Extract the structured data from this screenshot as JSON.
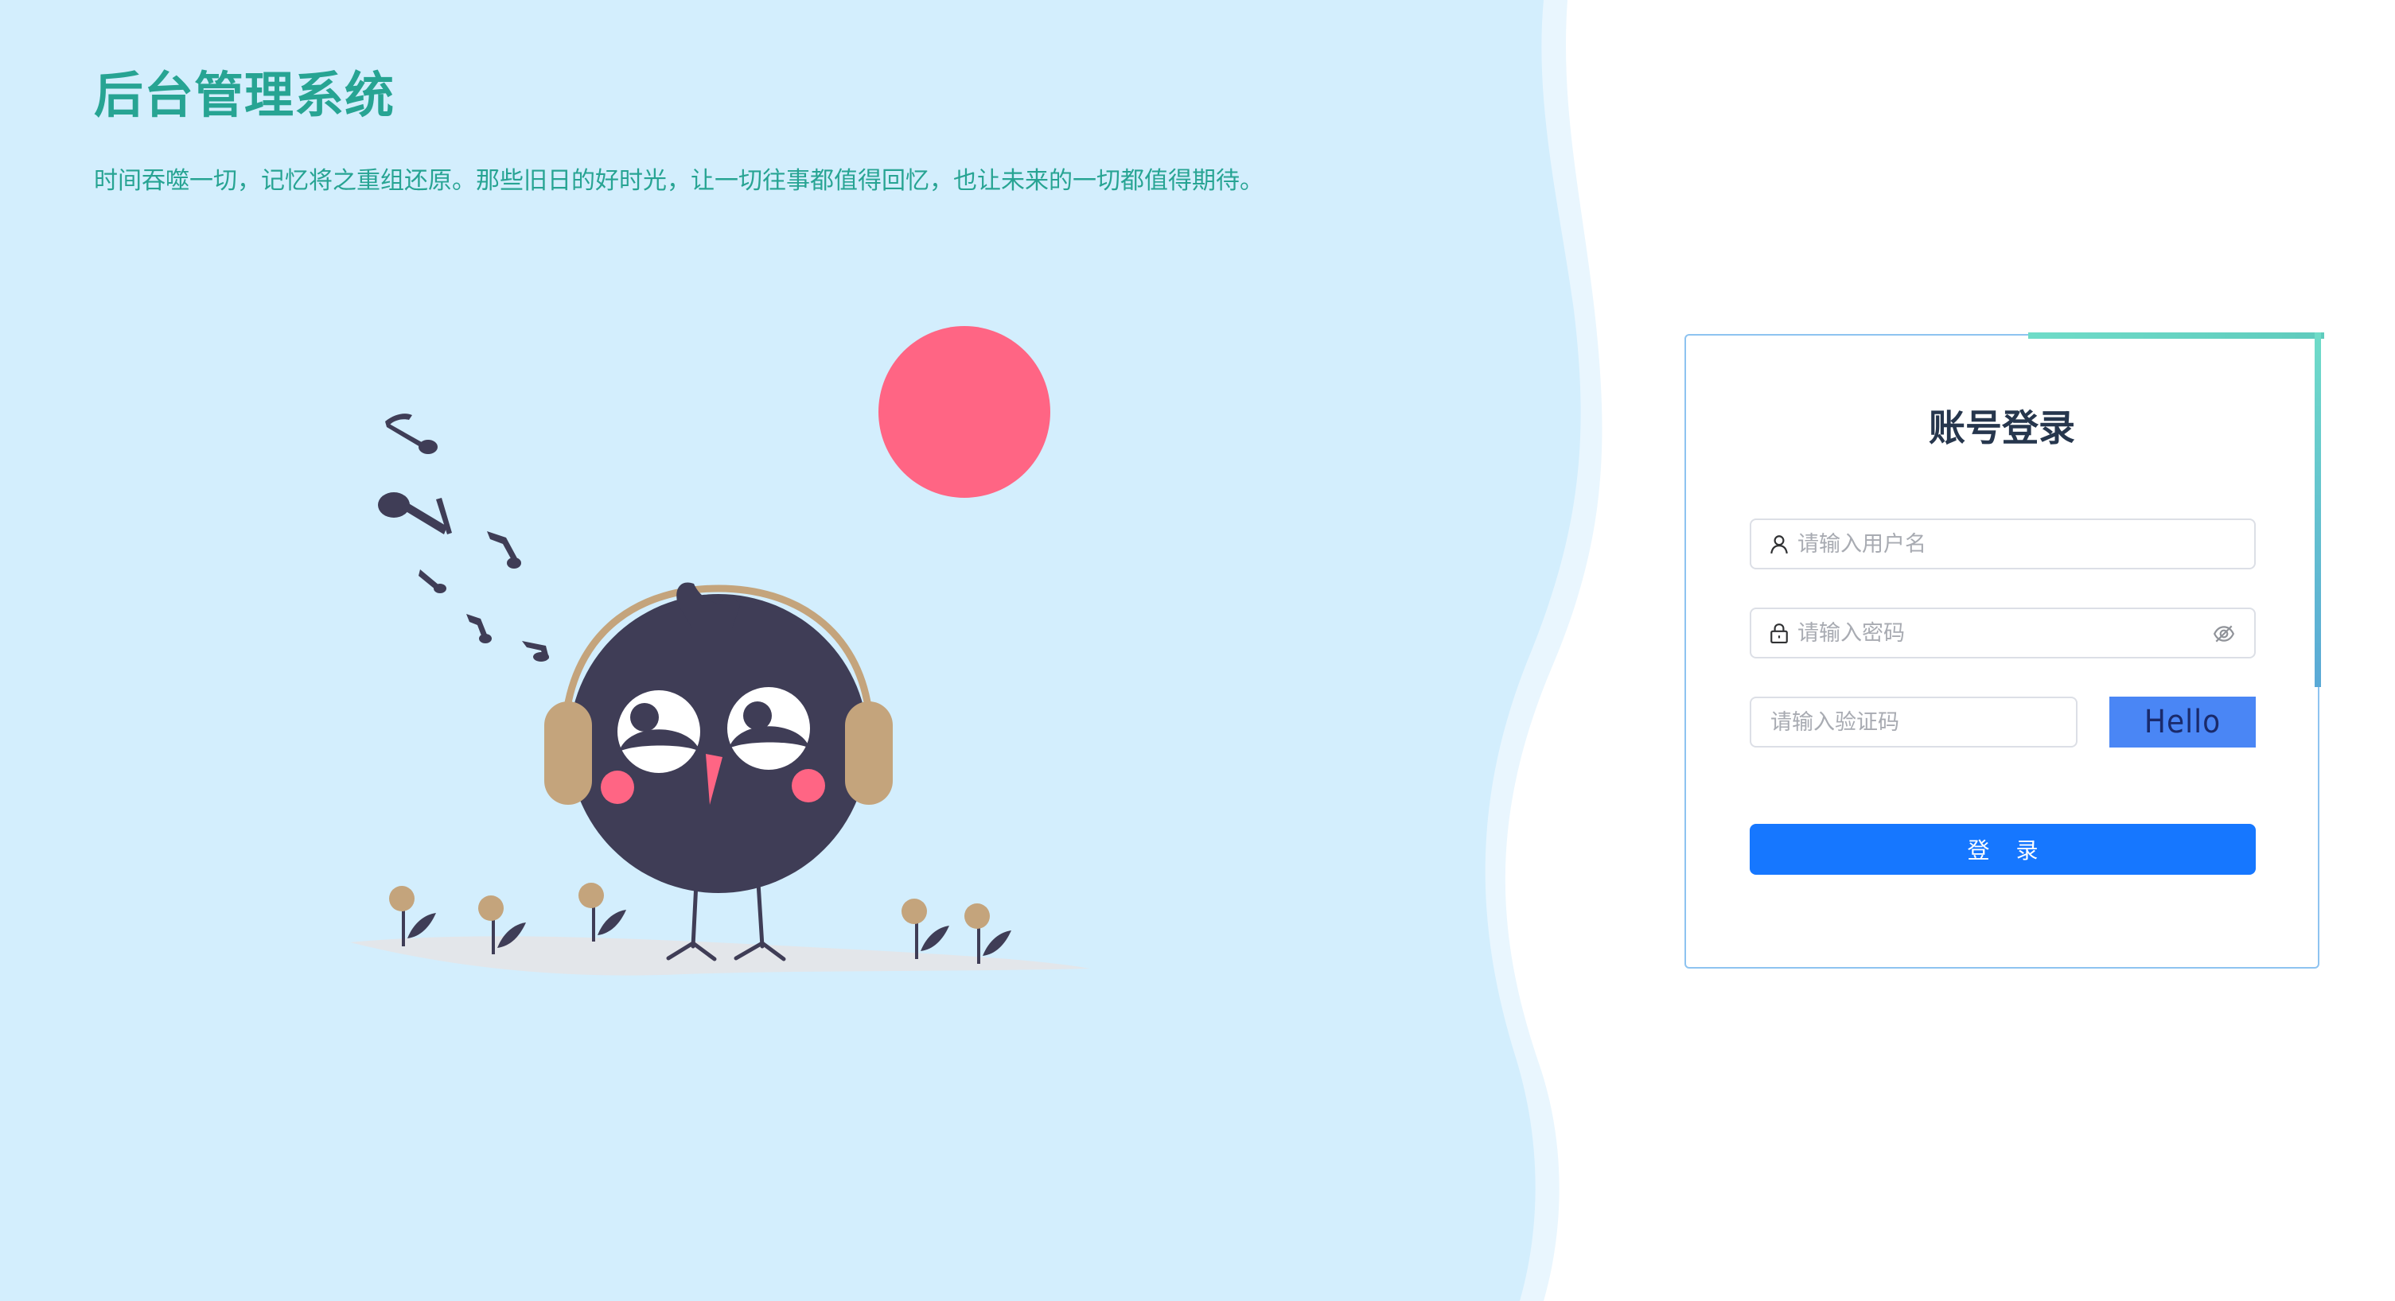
{
  "app": {
    "title": "后台管理系统",
    "subtitle": "时间吞噬一切，记忆将之重组还原。那些旧日的好时光，让一切往事都值得回忆，也让未来的一切都值得期待。"
  },
  "login": {
    "heading": "账号登录",
    "username_placeholder": "请输入用户名",
    "password_placeholder": "请输入密码",
    "captcha_placeholder": "请输入验证码",
    "captcha_text": "Hello",
    "submit_label": "登 录"
  },
  "icons": {
    "username": "user-icon",
    "password": "lock-icon",
    "toggle_password": "eye-off-icon"
  },
  "colors": {
    "left_panel_bg": "#d3eefd",
    "title_text": "#27a493",
    "card_border": "#8ec3f0",
    "card_accent": "#6fdcc8",
    "primary_button": "#1677ff",
    "captcha_bg": "#4a86f5",
    "sun": "#ff6584",
    "bird_body": "#3f3d56",
    "headphones": "#c4a47c"
  }
}
